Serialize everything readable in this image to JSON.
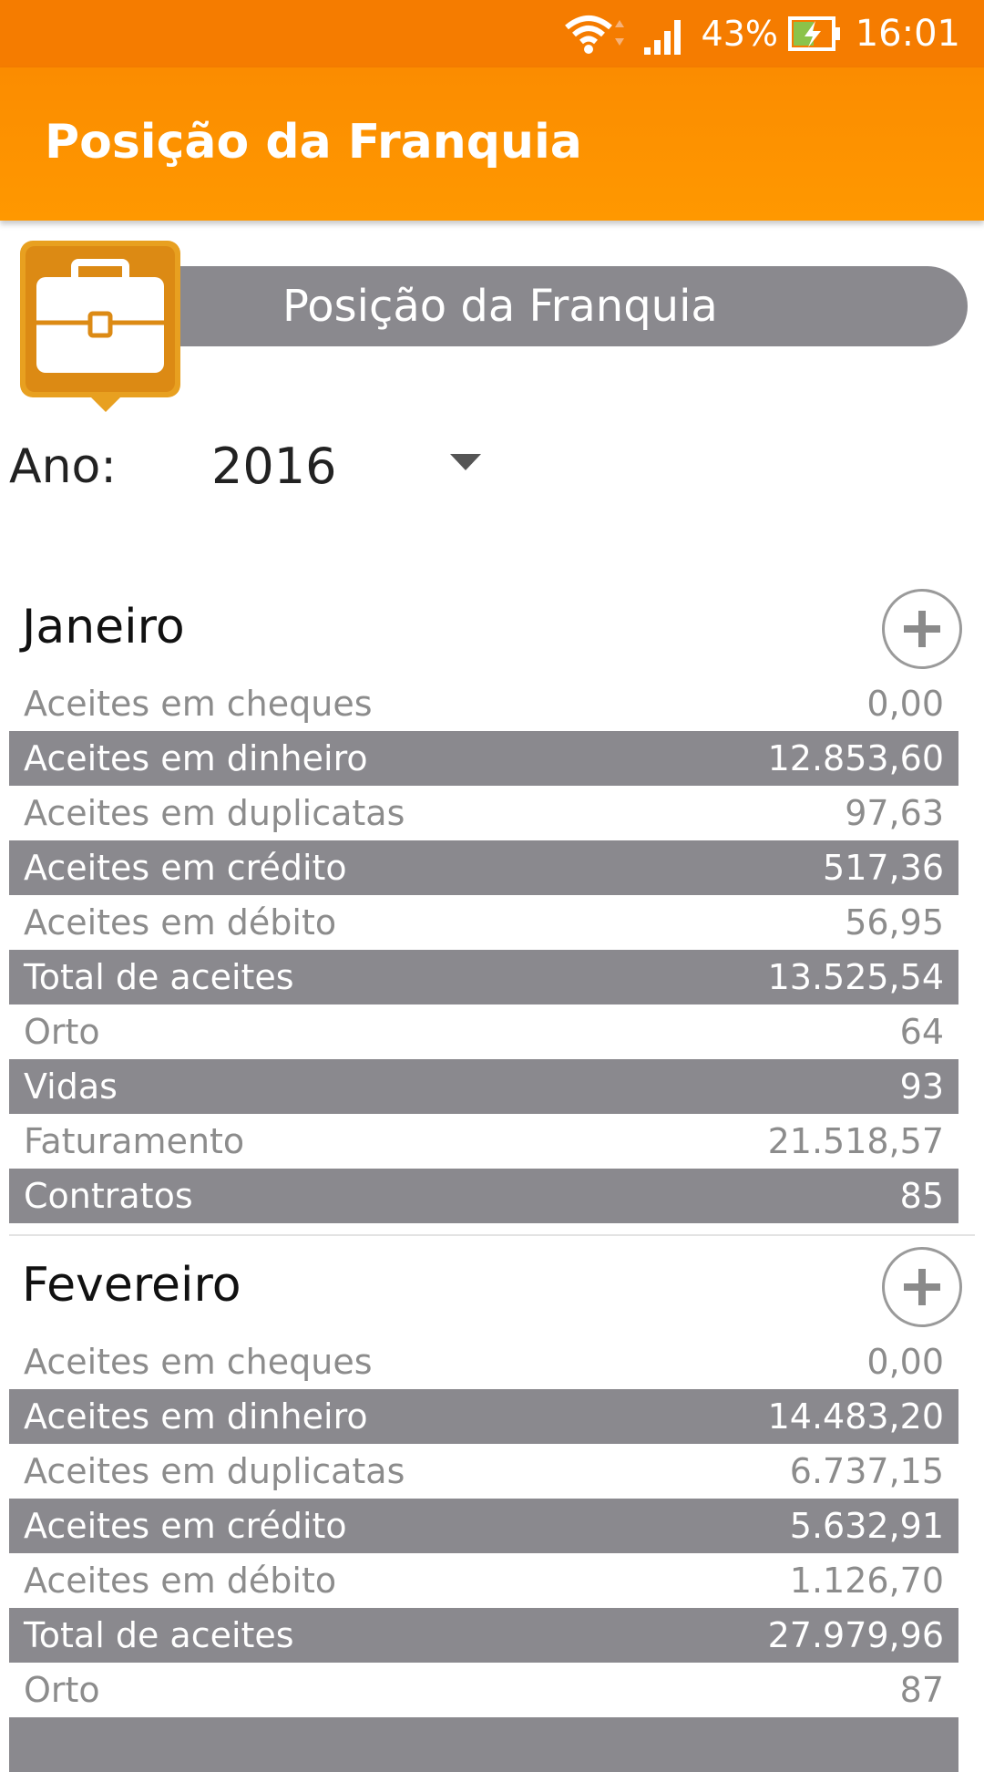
{
  "status_bar": {
    "battery_percent": "43%",
    "time": "16:01",
    "icons": [
      "wifi-icon",
      "signal-icon",
      "battery-charging-icon"
    ]
  },
  "app_bar": {
    "title": "Posição da Franquia"
  },
  "header": {
    "title": "Posição da Franquia",
    "icon": "briefcase-icon"
  },
  "year_filter": {
    "label": "Ano:",
    "selected": "2016"
  },
  "months": [
    {
      "name": "Janeiro",
      "rows": [
        {
          "label": "Aceites em cheques",
          "value": "0,00"
        },
        {
          "label": "Aceites em dinheiro",
          "value": "12.853,60"
        },
        {
          "label": "Aceites em duplicatas",
          "value": "97,63"
        },
        {
          "label": "Aceites em crédito",
          "value": "517,36"
        },
        {
          "label": "Aceites em débito",
          "value": "56,95"
        },
        {
          "label": "Total de aceites",
          "value": "13.525,54"
        },
        {
          "label": "Orto",
          "value": "64"
        },
        {
          "label": "Vidas",
          "value": "93"
        },
        {
          "label": "Faturamento",
          "value": "21.518,57"
        },
        {
          "label": "Contratos",
          "value": "85"
        }
      ]
    },
    {
      "name": "Fevereiro",
      "rows": [
        {
          "label": "Aceites em cheques",
          "value": "0,00"
        },
        {
          "label": "Aceites em dinheiro",
          "value": "14.483,20"
        },
        {
          "label": "Aceites em duplicatas",
          "value": "6.737,15"
        },
        {
          "label": "Aceites em crédito",
          "value": "5.632,91"
        },
        {
          "label": "Aceites em débito",
          "value": "1.126,70"
        },
        {
          "label": "Total de aceites",
          "value": "27.979,96"
        },
        {
          "label": "Orto",
          "value": "87"
        }
      ]
    }
  ]
}
